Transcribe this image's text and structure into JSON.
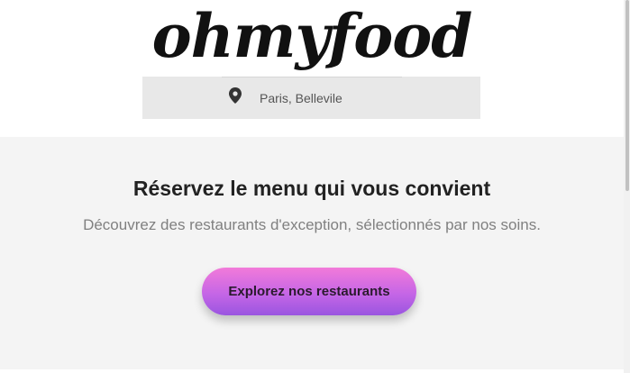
{
  "header": {
    "logo_text": "ohmyfood",
    "location": {
      "icon": "map-pin-icon",
      "text": "Paris, Bellevile"
    }
  },
  "hero": {
    "title": "Réservez le menu qui vous convient",
    "subtitle": "Découvrez des restaurants d'exception, sélectionnés par nos soins.",
    "cta_label": "Explorez nos restaurants"
  },
  "colors": {
    "cta_gradient_top": "#f27ad9",
    "cta_gradient_bottom": "#9a55e0",
    "hero_background": "#f4f4f4",
    "location_bar_background": "#e8e8e8"
  }
}
